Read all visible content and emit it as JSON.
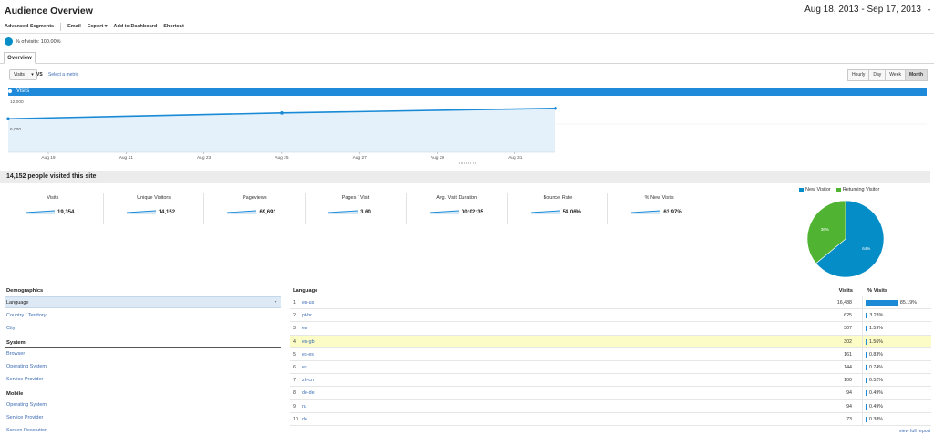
{
  "header": {
    "title": "Audience Overview",
    "date_range": "Aug 18, 2013 - Sep 17, 2013",
    "date_caret": "▾"
  },
  "toolbar": {
    "advanced_segments": "Advanced Segments",
    "email": "Email",
    "export": "Export ▾",
    "add_to_dashboard": "Add to Dashboard",
    "shortcut": "Shortcut"
  },
  "segment": {
    "label": "% of visits: 100.00%"
  },
  "tabs": {
    "overview": "Overview"
  },
  "chart_controls": {
    "metric": "Visits",
    "metric_caret": "▾",
    "vs": "VS",
    "select_metric": "Select a metric",
    "periods": [
      "Hourly",
      "Day",
      "Week",
      "Month"
    ],
    "active_period": "Month"
  },
  "chart_data": {
    "type": "line",
    "title": "",
    "legend": "Visits",
    "x": [
      "Aug 18",
      "Sep 1",
      "Sep 17"
    ],
    "x_tick_labels": [
      "Aug 19",
      "Aug 21",
      "Aug 23",
      "Aug 25",
      "Aug 27",
      "Aug 29",
      "Aug 31"
    ],
    "series": [
      {
        "name": "Visits",
        "values": [
          8000,
          9400,
          10500
        ]
      }
    ],
    "y_tick_labels": [
      "12,000",
      "6,000"
    ],
    "ylim": [
      0,
      13500
    ],
    "color": "#1a8ad6",
    "fill": "#e4f1fa"
  },
  "summary": {
    "title": "14,152 people visited this site",
    "metrics": [
      {
        "label": "Visits",
        "value": "19,354"
      },
      {
        "label": "Unique Visitors",
        "value": "14,152"
      },
      {
        "label": "Pageviews",
        "value": "69,691"
      },
      {
        "label": "Pages / Visit",
        "value": "3.60"
      },
      {
        "label": "Avg. Visit Duration",
        "value": "00:02:35"
      },
      {
        "label": "Bounce Rate",
        "value": "54.06%"
      },
      {
        "label": "% New Visits",
        "value": "63.97%"
      }
    ]
  },
  "pie": {
    "legend": [
      {
        "label": "New Visitor",
        "color": "#058dc7"
      },
      {
        "label": "Returning Visitor",
        "color": "#50b432"
      }
    ],
    "values": [
      64.0,
      36.0
    ],
    "slice_labels": [
      "64%",
      "36%"
    ]
  },
  "left_nav": {
    "demographics": "Demographics",
    "language": "Language",
    "language_arrow": "▸",
    "country": "Country / Territory",
    "city": "City",
    "system": "System",
    "browser": "Browser",
    "os": "Operating System",
    "service_provider": "Service Provider",
    "mobile": "Mobile",
    "mobile_os": "Operating System",
    "mobile_sp": "Service Provider",
    "screen_res": "Screen Resolution"
  },
  "table": {
    "headers": {
      "language": "Language",
      "visits": "Visits",
      "pct": "% Visits"
    },
    "rows": [
      {
        "num": "1.",
        "lang": "en-us",
        "visits": "16,488",
        "pct": "85.19%",
        "share": 85.19
      },
      {
        "num": "2.",
        "lang": "pt-br",
        "visits": "625",
        "pct": "3.23%",
        "share": 3.23
      },
      {
        "num": "3.",
        "lang": "en",
        "visits": "307",
        "pct": "1.59%",
        "share": 1.59
      },
      {
        "num": "4.",
        "lang": "en-gb",
        "visits": "302",
        "pct": "1.56%",
        "share": 1.56
      },
      {
        "num": "5.",
        "lang": "es-es",
        "visits": "161",
        "pct": "0.83%",
        "share": 0.83
      },
      {
        "num": "6.",
        "lang": "es",
        "visits": "144",
        "pct": "0.74%",
        "share": 0.74
      },
      {
        "num": "7.",
        "lang": "zh-cn",
        "visits": "100",
        "pct": "0.52%",
        "share": 0.52
      },
      {
        "num": "8.",
        "lang": "de-de",
        "visits": "94",
        "pct": "0.49%",
        "share": 0.49
      },
      {
        "num": "9.",
        "lang": "ru",
        "visits": "94",
        "pct": "0.49%",
        "share": 0.49
      },
      {
        "num": "10.",
        "lang": "de",
        "visits": "73",
        "pct": "0.38%",
        "share": 0.38
      }
    ],
    "highlight_row": 3,
    "view_full": "view full report"
  }
}
